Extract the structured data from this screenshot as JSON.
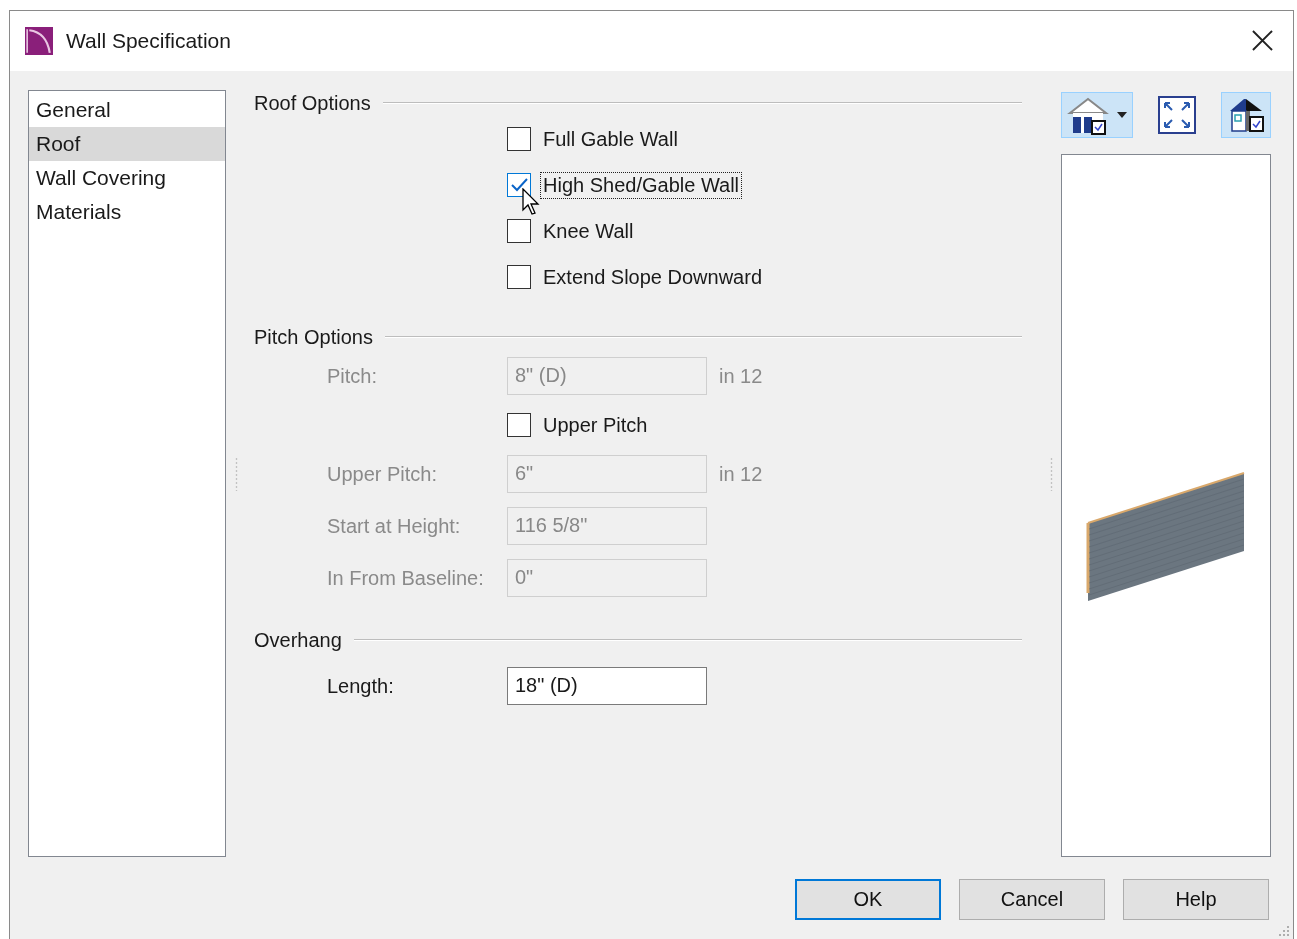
{
  "window": {
    "title": "Wall Specification"
  },
  "nav": [
    {
      "label": "General",
      "selected": false
    },
    {
      "label": "Roof",
      "selected": true
    },
    {
      "label": "Wall Covering",
      "selected": false
    },
    {
      "label": "Materials",
      "selected": false
    }
  ],
  "roof_options": {
    "title": "Roof Options",
    "checkboxes": [
      {
        "label": "Full Gable Wall",
        "checked": false,
        "focused": false
      },
      {
        "label": "High Shed/Gable Wall",
        "checked": true,
        "focused": true
      },
      {
        "label": "Knee Wall",
        "checked": false,
        "focused": false
      },
      {
        "label": "Extend Slope Downward",
        "checked": false,
        "focused": false
      }
    ]
  },
  "pitch_options": {
    "title": "Pitch Options",
    "rows": [
      {
        "kind": "field",
        "label": "Pitch:",
        "value": "8\" (D)",
        "unit": "in 12",
        "disabled": true
      },
      {
        "kind": "checkbox",
        "label": "Upper Pitch",
        "checked": false
      },
      {
        "kind": "field",
        "label": "Upper Pitch:",
        "value": "6\"",
        "unit": "in 12",
        "disabled": true
      },
      {
        "kind": "field",
        "label": "Start at Height:",
        "value": "116 5/8\"",
        "disabled": true
      },
      {
        "kind": "field",
        "label": "In From Baseline:",
        "value": "0\"",
        "disabled": true
      }
    ]
  },
  "overhang": {
    "title": "Overhang",
    "rows": [
      {
        "kind": "field",
        "label": "Length:",
        "value": "18\" (D)",
        "disabled": false
      }
    ]
  },
  "preview_toolbar": [
    {
      "kind": "house-view",
      "selected": true
    },
    {
      "kind": "fit",
      "selected": false
    },
    {
      "kind": "house-check",
      "selected": true
    }
  ],
  "buttons": [
    {
      "label": "OK",
      "default": true
    },
    {
      "label": "Cancel",
      "default": false
    },
    {
      "label": "Help",
      "default": false
    }
  ]
}
